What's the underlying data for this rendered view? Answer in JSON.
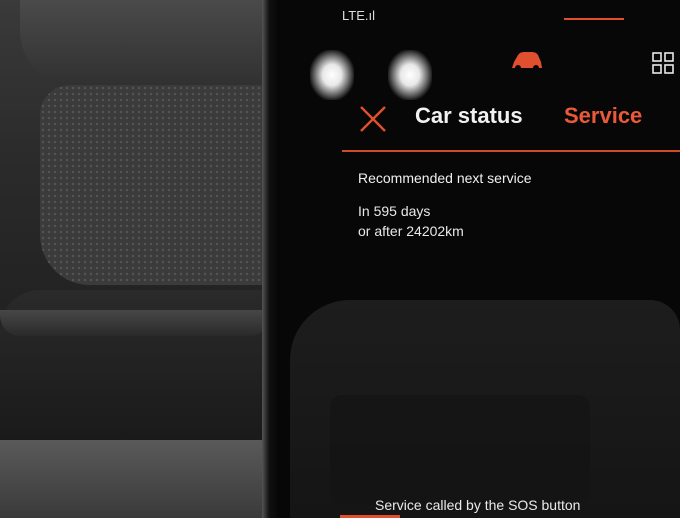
{
  "status_bar": {
    "network": "LTE.ıl"
  },
  "tabs": {
    "car_status": "Car status",
    "service": "Service"
  },
  "service": {
    "title": "Recommended next service",
    "days": "In 595 days",
    "km": "or after 24202km",
    "sos_note": "Service called by the SOS button"
  },
  "colors": {
    "accent": "#e0502e",
    "text": "#f0f0f0",
    "background": "#070707"
  },
  "icons": [
    "car-icon",
    "grid-icon",
    "close-icon"
  ]
}
